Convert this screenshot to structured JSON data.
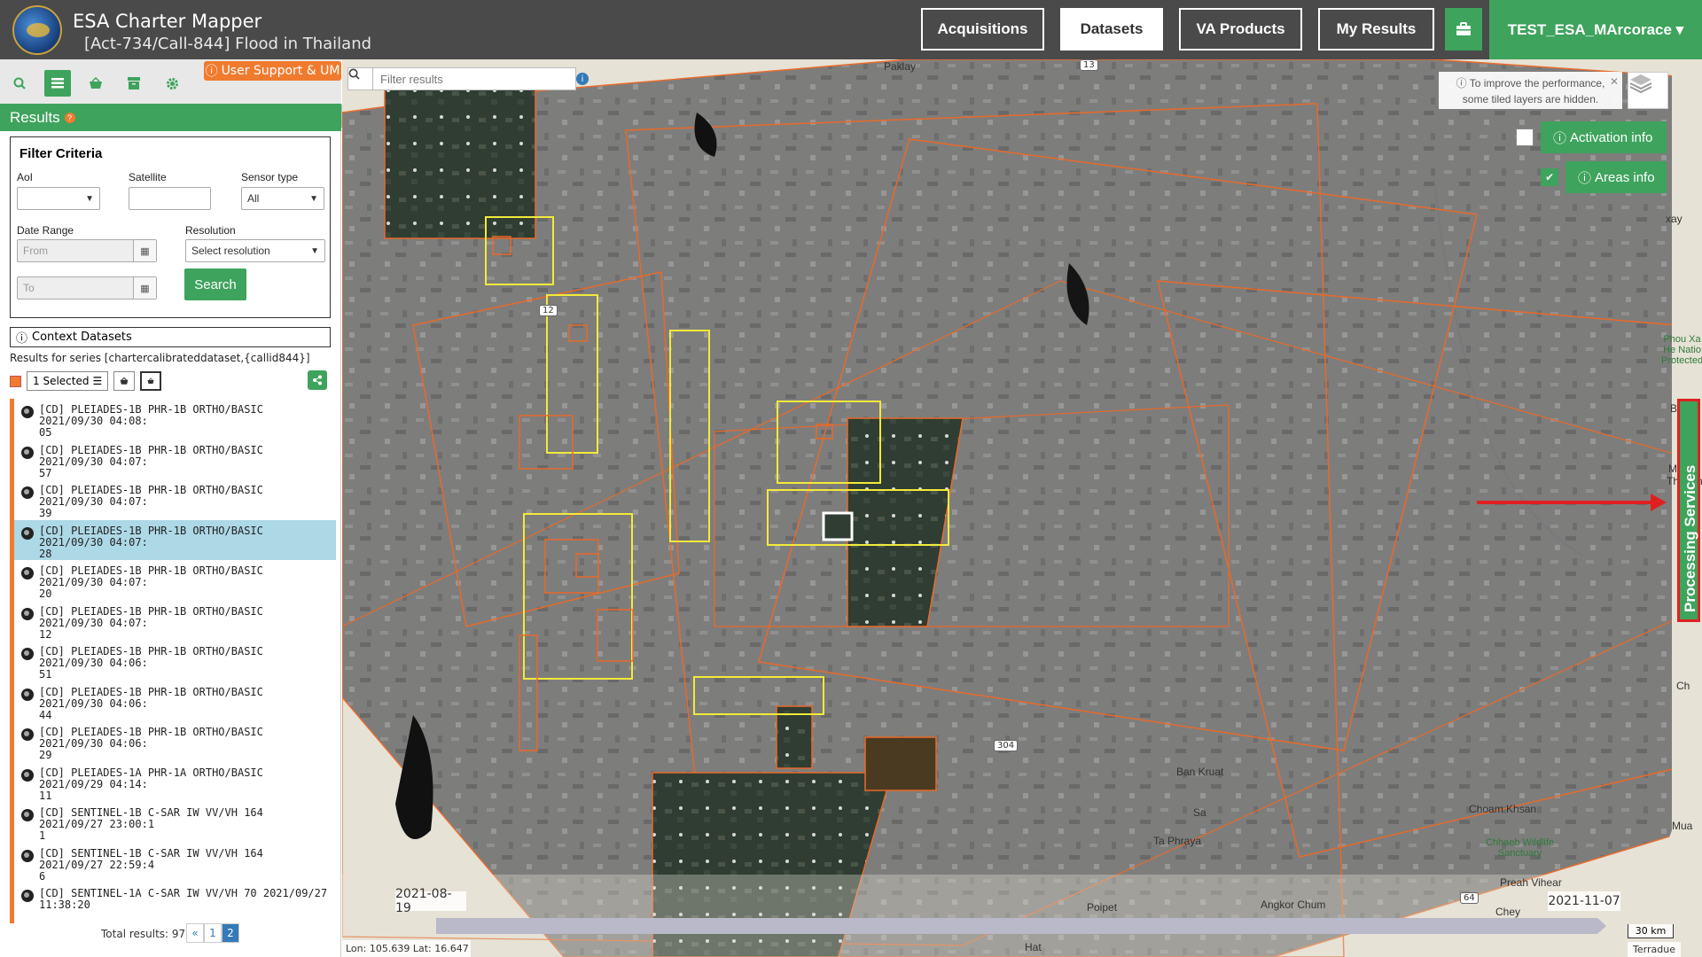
{
  "header": {
    "title": "ESA Charter Mapper",
    "subtitle": "[Act-734/Call-844] Flood in Thailand",
    "nav": [
      {
        "label": "Acquisitions",
        "active": false
      },
      {
        "label": "Datasets",
        "active": true
      },
      {
        "label": "VA Products",
        "active": false
      },
      {
        "label": "My Results",
        "active": false
      }
    ],
    "user": "TEST_ESA_MArcorace ▾"
  },
  "left": {
    "support": "User Support & UM",
    "results_title": "Results",
    "filter": {
      "title": "Filter Criteria",
      "aoi_label": "AoI",
      "aoi_value": "",
      "satellite_label": "Satellite",
      "satellite_value": "",
      "sensor_label": "Sensor type",
      "sensor_value": "All",
      "date_label": "Date Range",
      "from_placeholder": "From",
      "to_placeholder": "To",
      "resolution_label": "Resolution",
      "resolution_value": "Select resolution",
      "search": "Search"
    },
    "context": "Context Datasets",
    "series": "Results for series [chartercalibrateddataset,{callid844}]",
    "selected": "1 Selected",
    "items": [
      {
        "l1": "[CD] PLEIADES-1B PHR-1B ORTHO/BASIC 2021/09/30 04:08:",
        "l2": "05"
      },
      {
        "l1": "[CD] PLEIADES-1B PHR-1B ORTHO/BASIC 2021/09/30 04:07:",
        "l2": "57"
      },
      {
        "l1": "[CD] PLEIADES-1B PHR-1B ORTHO/BASIC 2021/09/30 04:07:",
        "l2": "39"
      },
      {
        "l1": "[CD] PLEIADES-1B PHR-1B ORTHO/BASIC 2021/09/30 04:07:",
        "l2": "28"
      },
      {
        "l1": "[CD] PLEIADES-1B PHR-1B ORTHO/BASIC 2021/09/30 04:07:",
        "l2": "20"
      },
      {
        "l1": "[CD] PLEIADES-1B PHR-1B ORTHO/BASIC 2021/09/30 04:07:",
        "l2": "12"
      },
      {
        "l1": "[CD] PLEIADES-1B PHR-1B ORTHO/BASIC 2021/09/30 04:06:",
        "l2": "51"
      },
      {
        "l1": "[CD] PLEIADES-1B PHR-1B ORTHO/BASIC 2021/09/30 04:06:",
        "l2": "44"
      },
      {
        "l1": "[CD] PLEIADES-1B PHR-1B ORTHO/BASIC 2021/09/30 04:06:",
        "l2": "29"
      },
      {
        "l1": "[CD] PLEIADES-1A PHR-1A ORTHO/BASIC 2021/09/29 04:14:",
        "l2": "11"
      },
      {
        "l1": "[CD] SENTINEL-1B C-SAR IW VV/VH 164 2021/09/27 23:00:1",
        "l2": "1"
      },
      {
        "l1": "[CD] SENTINEL-1B C-SAR IW VV/VH 164 2021/09/27 22:59:4",
        "l2": "6"
      },
      {
        "l1": "[CD] SENTINEL-1A C-SAR IW VV/VH 70 2021/09/27 11:38:20",
        "l2": ""
      }
    ],
    "selected_index": 3,
    "total": "Total results: 97",
    "pages": [
      "«",
      "1",
      "2"
    ],
    "active_page": "2"
  },
  "map": {
    "filter_placeholder": "Filter results",
    "perf_note": "To improve the performance, some tiled layers are hidden.",
    "activation_info": "Activation info",
    "areas_info": "Areas info",
    "processing": "Processing Services",
    "date_start": "2021-08-19",
    "date_end": "2021-11-07",
    "coords": "Lon: 105.639 Lat: 16.647",
    "scale": "30 km",
    "attribution": "Terradue",
    "places": {
      "paklay": "Paklay",
      "bankruat": "Ban Kruat",
      "taphraya": "Ta Phraya",
      "poipet": "Poipet",
      "angkor": "Angkor Chum",
      "preah": "Preah Vihear",
      "choam": "Choam Khsan",
      "chhaeb": "Chhaeb Wildlife\nSanctuary",
      "phou": "Phou Xa\nHe Natio\nProtected",
      "hat": "Hat",
      "chey": "Chey",
      "sa": "Sa",
      "mua": "Mua",
      "thapan": "Thapan",
      "cha": "Ch",
      "xay": "xay",
      "bua": "Bua",
      "sne": "S"
    },
    "roads": {
      "r12": "12",
      "r304": "304",
      "r64": "64",
      "r13": "13"
    }
  }
}
